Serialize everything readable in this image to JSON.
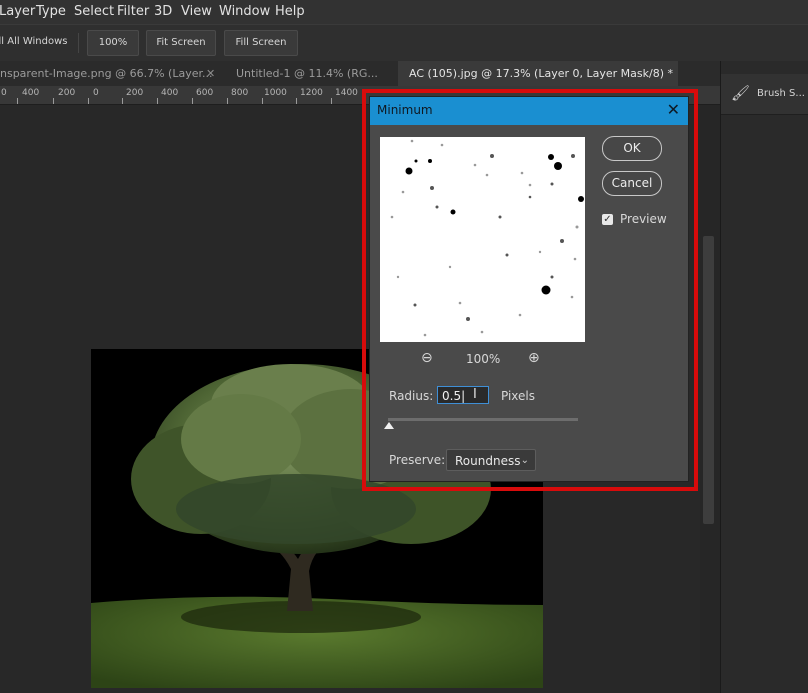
{
  "menu": [
    "Layer",
    "Type",
    "Select",
    "Filter",
    "3D",
    "View",
    "Window",
    "Help"
  ],
  "options_bar": {
    "scroll_all_windows": "ll All Windows",
    "zoom_100": "100%",
    "fit_screen": "Fit Screen",
    "fill_screen": "Fill Screen"
  },
  "tabs": [
    {
      "label": "nsparent-Image.png @ 66.7% (Layer..."
    },
    {
      "label": "Untitled-1 @ 11.4% (RG..."
    },
    {
      "label": "AC (105).jpg @ 17.3% (Layer 0, Layer Mask/8) *"
    }
  ],
  "ruler_labels": [
    "0",
    "400",
    "200",
    "0",
    "200",
    "400",
    "600",
    "800",
    "1000",
    "1200",
    "1400"
  ],
  "right_panel": {
    "brush_settings": "Brush S..."
  },
  "dialog": {
    "title": "Minimum",
    "ok": "OK",
    "cancel": "Cancel",
    "preview_label": "Preview",
    "preview_checked": true,
    "zoom_level": "100%",
    "radius_label": "Radius:",
    "radius_value": "0.5",
    "radius_unit": "Pixels",
    "radius_slider_fraction": 0.0,
    "preserve_label": "Preserve:",
    "preserve_value": "Roundness"
  },
  "colors": {
    "dialog_title_bg": "#1a8fd1",
    "highlight": "#d80b0b"
  }
}
